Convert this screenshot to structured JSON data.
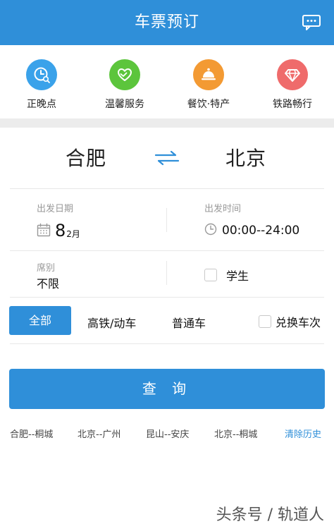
{
  "header": {
    "title": "车票预订",
    "icon": "chat-bubble-icon"
  },
  "quick_links": [
    {
      "label": "正晚点",
      "icon": "clock-search-icon",
      "color": "#3aa2ea"
    },
    {
      "label": "温馨服务",
      "icon": "heart-hands-icon",
      "color": "#5cc53c"
    },
    {
      "label": "餐饮·特产",
      "icon": "food-cloche-icon",
      "color": "#f39a33"
    },
    {
      "label": "铁路畅行",
      "icon": "diamond-icon",
      "color": "#ef6b6b"
    }
  ],
  "route": {
    "from": "合肥",
    "to": "北京",
    "swap_icon": "swap-arrows-icon"
  },
  "departure_date": {
    "label": "出发日期",
    "day": "8",
    "month": "2月",
    "icon": "calendar-icon"
  },
  "departure_time": {
    "label": "出发时间",
    "value": "00:00--24:00",
    "icon": "clock-icon"
  },
  "seat": {
    "label": "席别",
    "value": "不限"
  },
  "student": {
    "label": "学生",
    "checked": false
  },
  "filters": {
    "all": "全部",
    "high_speed": "高铁/动车",
    "regular": "普通车",
    "exchange": "兑换车次"
  },
  "query_button": "查 询",
  "history": [
    "合肥--桐城",
    "北京--广州",
    "昆山--安庆",
    "北京--桐城"
  ],
  "clear_history": "清除历史",
  "watermark": "头条号 / 轨道人",
  "colors": {
    "primary": "#2f8fd9",
    "divider": "#e8e8e8",
    "band": "#ececec"
  }
}
